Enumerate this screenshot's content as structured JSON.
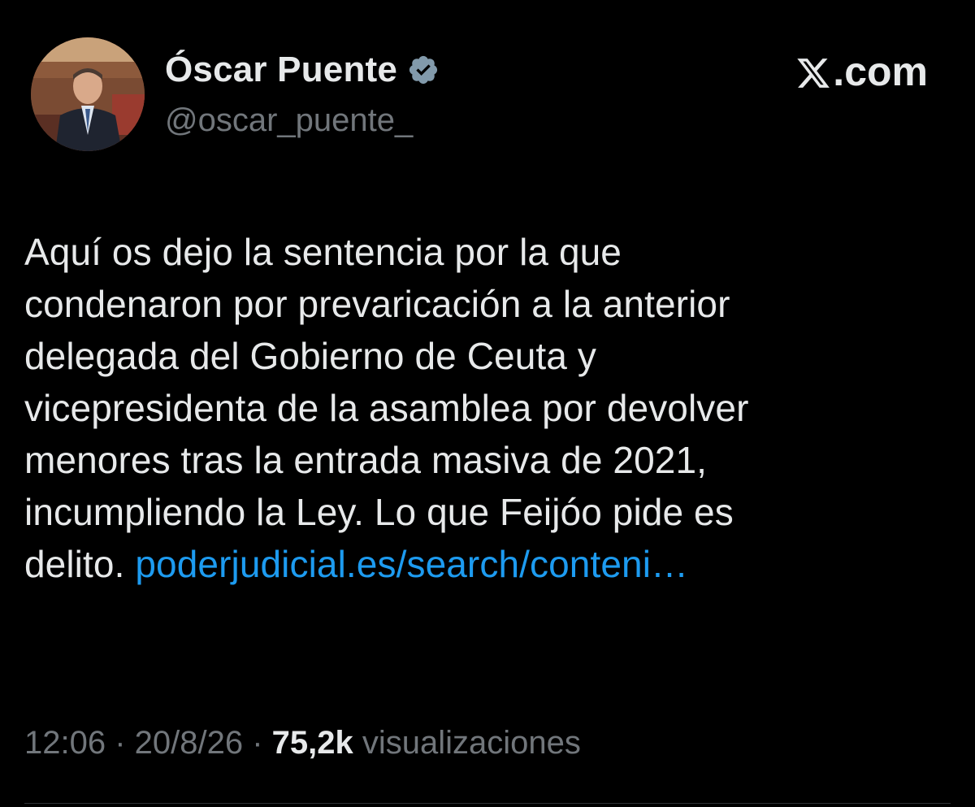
{
  "author": {
    "display_name": "Óscar Puente",
    "handle": "@oscar_puente_",
    "verified_icon": "verified-badge-icon",
    "avatar": "profile-photo"
  },
  "brand": {
    "logo_icon": "x-logo-icon",
    "label": ".com"
  },
  "tweet": {
    "text_lines": [
      "Aquí os dejo la sentencia por la que",
      "condenaron por prevaricación a la anterior",
      "delegada del Gobierno de Ceuta y",
      "vicepresidenta de la asamblea por devolver",
      "menores tras la entrada masiva de 2021,",
      "incumpliendo la Ley. Lo que Feijóo pide es",
      "delito. "
    ],
    "link": "poderjudicial.es/search/conteni…"
  },
  "meta": {
    "time": "12:06",
    "separator": " · ",
    "date": "20/8/26",
    "views_count": "75,2k",
    "views_label": " visualizaciones"
  },
  "colors": {
    "background": "#000000",
    "text": "#e7e9ea",
    "secondary": "#71767b",
    "link": "#1d9bf0",
    "verified_badge": "#829aab"
  }
}
